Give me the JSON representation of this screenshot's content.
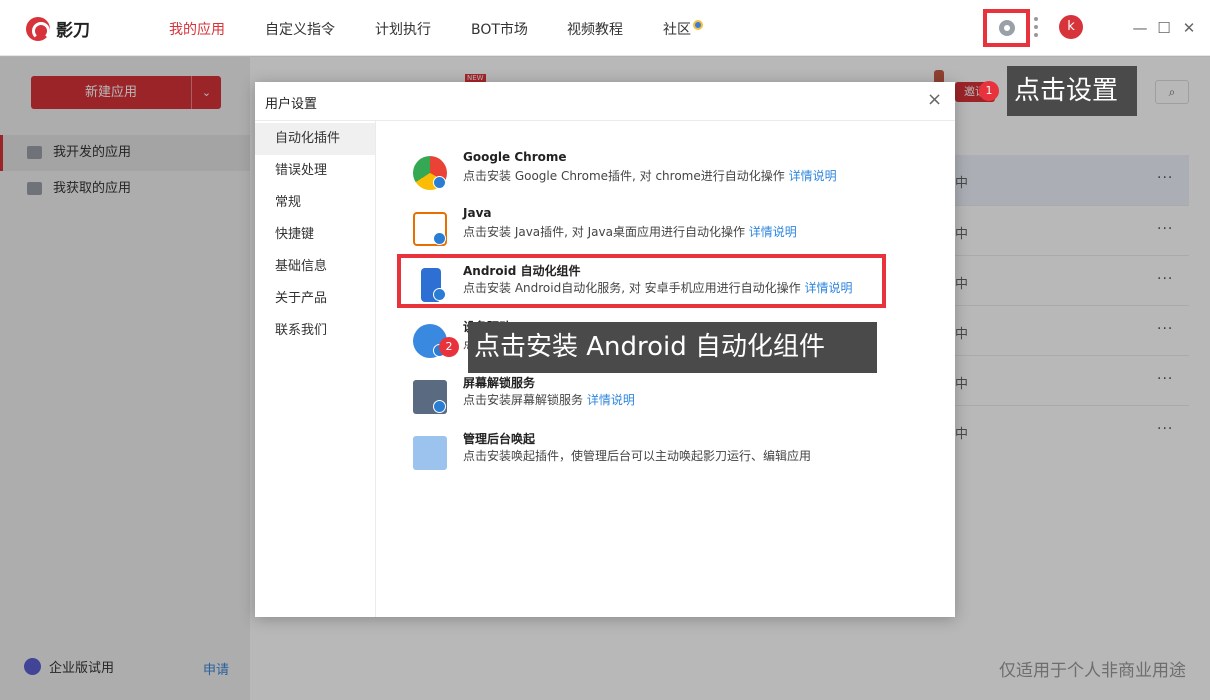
{
  "app": {
    "name": "影刀"
  },
  "nav": {
    "items": [
      {
        "label": "我的应用",
        "active": true
      },
      {
        "label": "自定义指令",
        "active": false
      },
      {
        "label": "计划执行",
        "active": false
      },
      {
        "label": "BOT市场",
        "active": false
      },
      {
        "label": "视频教程",
        "active": false
      },
      {
        "label": "社区",
        "active": false
      }
    ]
  },
  "header": {
    "avatar_letter": "k",
    "window_controls": [
      "—",
      "☐",
      "✕"
    ]
  },
  "sidebar": {
    "new_app_label": "新建应用",
    "items": [
      {
        "label": "我开发的应用",
        "active": true
      },
      {
        "label": "我获取的应用",
        "active": false
      }
    ],
    "enterprise_label": "企业版试用",
    "apply_link": "申请"
  },
  "main": {
    "new_tag": "NEW",
    "invite_label": "邀请",
    "row_status": [
      "中",
      "中",
      "中",
      "中",
      "中",
      "中"
    ],
    "row_more": "···",
    "watermark": "仅适用于个人非商业用途"
  },
  "dialog": {
    "title": "用户设置",
    "close_glyph": "×",
    "nav": [
      {
        "label": "自动化插件",
        "active": true
      },
      {
        "label": "错误处理",
        "active": false
      },
      {
        "label": "常规",
        "active": false
      },
      {
        "label": "快捷键",
        "active": false
      },
      {
        "label": "基础信息",
        "active": false
      },
      {
        "label": "关于产品",
        "active": false
      },
      {
        "label": "联系我们",
        "active": false
      }
    ],
    "plugins": [
      {
        "name": "Google Chrome",
        "desc": "点击安装 Google Chrome插件, 对 chrome进行自动化操作",
        "link": "详情说明",
        "icon": "chrome-icon"
      },
      {
        "name": "Java",
        "desc": "点击安装 Java插件, 对 Java桌面应用进行自动化操作",
        "link": "详情说明",
        "icon": "java-icon"
      },
      {
        "name": "Android 自动化组件",
        "desc": "点击安装 Android自动化服务, 对 安卓手机应用进行自动化操作",
        "link": "详情说明",
        "icon": "android-phone-icon"
      },
      {
        "name": "设备驱动",
        "desc": "点",
        "link": "",
        "icon": "device-driver-icon"
      },
      {
        "name": "屏幕解锁服务",
        "desc": "点击安装屏幕解锁服务",
        "link": "详情说明",
        "icon": "screen-unlock-icon"
      },
      {
        "name": "管理后台唤起",
        "desc": "点击安装唤起插件，使管理后台可以主动唤起影刀运行、编辑应用",
        "link": "",
        "icon": "admin-wakeup-icon"
      }
    ]
  },
  "annotations": {
    "step1_number": "1",
    "step1_label": "点击设置",
    "step2_number": "2",
    "step2_label": "点击安装 Android 自动化组件"
  },
  "colors": {
    "brand": "#d7333a",
    "highlight": "#e8333c",
    "link": "#2e86de"
  }
}
